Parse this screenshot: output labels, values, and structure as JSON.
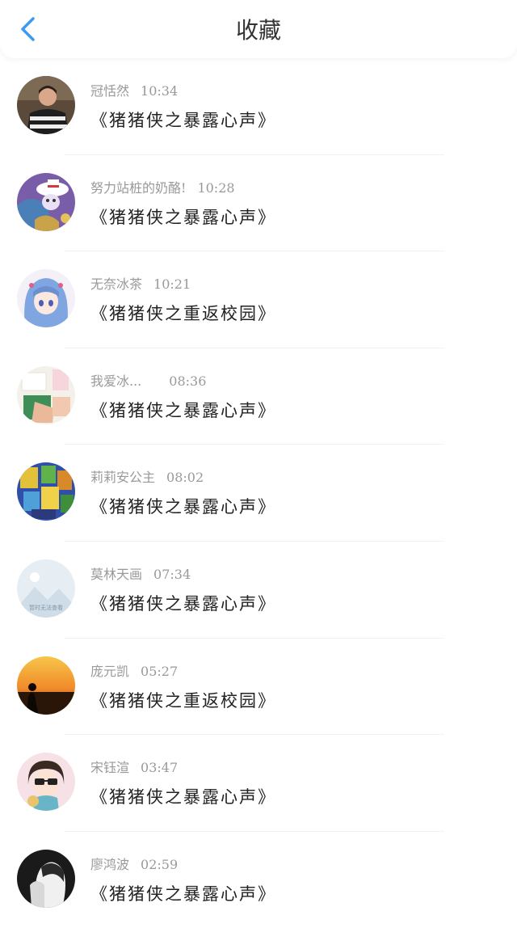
{
  "header": {
    "title": "收藏",
    "back_icon": "chevron-left-icon",
    "accent_color": "#3a9bf4"
  },
  "items": [
    {
      "user": "冠恬然",
      "time": "10:34",
      "title": "《猪猪侠之暴露心声》"
    },
    {
      "user": "努力站桩的奶酪!",
      "time": "10:28",
      "title": "《猪猪侠之暴露心声》"
    },
    {
      "user": "无奈冰茶",
      "time": "10:21",
      "title": "《猪猪侠之重返校园》"
    },
    {
      "user": "我爱冰...",
      "time": "08:36",
      "title": "《猪猪侠之暴露心声》"
    },
    {
      "user": "莉莉安公主",
      "time": "08:02",
      "title": "《猪猪侠之暴露心声》"
    },
    {
      "user": "莫林天画",
      "time": "07:34",
      "title": "《猪猪侠之暴露心声》",
      "avatar_caption": "暂时无法查看"
    },
    {
      "user": "庞元凯",
      "time": "05:27",
      "title": "《猪猪侠之重返校园》"
    },
    {
      "user": "宋钰渲",
      "time": "03:47",
      "title": "《猪猪侠之暴露心声》"
    },
    {
      "user": "廖鸿波",
      "time": "02:59",
      "title": "《猪猪侠之暴露心声》"
    }
  ]
}
